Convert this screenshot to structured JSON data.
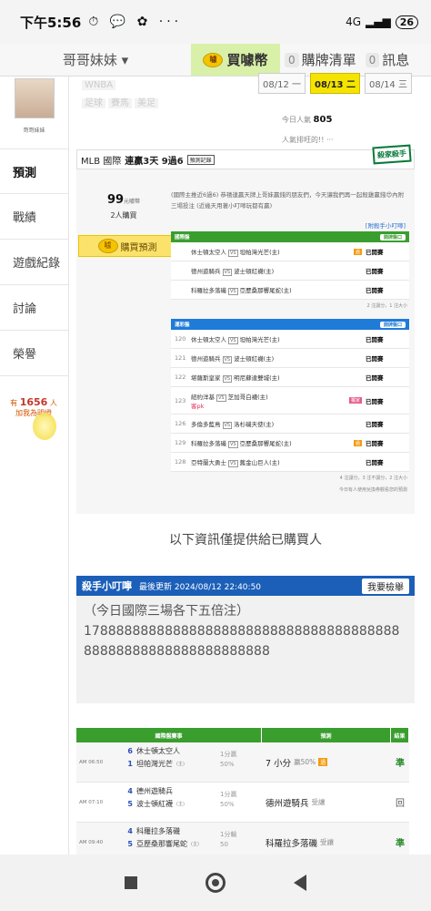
{
  "status": {
    "time": "下午5:56",
    "icons": "⏱ 💬 ✿ ···",
    "signal": "4G",
    "battery": "26"
  },
  "topnav": {
    "user": "哥哥妹妹 ▾",
    "buy": "買噱幣",
    "coin_text": "噱",
    "cart_count": "0",
    "cart_label": "購牌清單",
    "msg_count": "0",
    "msg_label": "訊息"
  },
  "sidebar": {
    "avatar_name": "哥哥妹妹",
    "items": [
      {
        "label": "預測"
      },
      {
        "label": "戰績"
      },
      {
        "label": "遊戲紀錄"
      },
      {
        "label": "討論"
      },
      {
        "label": "榮譽"
      }
    ],
    "fans_prefix": "有",
    "fans_count": "1656",
    "fans_suffix": "人",
    "fans_sub": "加我為明燈"
  },
  "tags": [
    "WNBA",
    "足球",
    "賽馬",
    "美足"
  ],
  "dates": [
    {
      "label": "08/12 一"
    },
    {
      "label": "08/13 二"
    },
    {
      "label": "08/14 三"
    }
  ],
  "popularity": {
    "label": "今日人氣",
    "value": "805",
    "sub": "人氣排旺的!! ···"
  },
  "panel": {
    "league": "MLB 國際",
    "streak": "連贏3天 9過6",
    "record_btn": "預測記錄",
    "logo": "殺家殺手",
    "price": "99",
    "price_unit": "元噱幣",
    "buyers": "2人購買",
    "buy_btn": "購買預測",
    "intro": "(國際主推近6過6) 恭禧連贏天牌上哥妹贏錢的朋友們，今天讓我們再一起殺雞贏錢😍內附三場投注 (近幾天用著小叮嚀玩都有贏)",
    "assist": "[附殺手小叮嚀]",
    "intl_title": "國際盤",
    "open_label": "開牌盤口",
    "intl_rows": [
      {
        "no": "",
        "home": "休士頓太空人",
        "away": "坦帕灣光芒(主)",
        "tag": "過",
        "status": "已開賽"
      },
      {
        "no": "",
        "home": "德州遊騎兵",
        "away": "波士頓紅襪(主)",
        "tag": "",
        "status": "已開賽"
      },
      {
        "no": "",
        "home": "科羅拉多落磯",
        "away": "亞歷桑那響尾蛇(主)",
        "tag": "",
        "status": "已開賽"
      }
    ],
    "intl_note": "2 注讓分，1 注大小",
    "tw_title": "運彩盤",
    "tw_rows": [
      {
        "no": "120",
        "home": "休士頓太空人",
        "away": "坦帕灣光芒(主)",
        "tag": "",
        "status": "已開賽"
      },
      {
        "no": "121",
        "home": "德州遊騎兵",
        "away": "波士頓紅襪(主)",
        "tag": "",
        "status": "已開賽"
      },
      {
        "no": "122",
        "home": "堪薩斯皇家",
        "away": "明尼蘇達雙城(主)",
        "tag": "",
        "status": "已開賽"
      },
      {
        "no": "123",
        "home": "紐約洋基",
        "away": "芝加哥白襪(主)",
        "tag": "",
        "status": "已開賽",
        "extra": "客pk",
        "ptag": "獨家"
      },
      {
        "no": "126",
        "no2": "",
        "home": "多倫多藍鳥",
        "away": "洛杉磯天使(主)",
        "tag": "",
        "status": "已開賽"
      },
      {
        "no": "129",
        "home": "科羅拉多落磯",
        "away": "亞歷桑那響尾蛇(主)",
        "tag": "過",
        "status": "已開賽"
      },
      {
        "no": "128",
        "home": "亞特蘭大勇士",
        "away": "舊金山巨人(主)",
        "tag": "",
        "status": "已開賽"
      }
    ],
    "tw_note": "4 注讓分，3 注不讓分，2 注大小",
    "tw_note2": "今日有人使用兌換券觀看您的預測"
  },
  "notice": "以下資訊僅提供給已購買人",
  "tip": {
    "title": "殺手小叮嚀",
    "updated": "最後更新 2024/08/12 22:40:50",
    "report": "我要檢舉",
    "body": "（今日國際三場各下五倍注）\n17888888888888888888888888888888888888888888888888888888888888"
  },
  "results": {
    "headers": [
      "國際盤賽事",
      "預測",
      "結果"
    ],
    "rows": [
      {
        "time": "AM 06:50",
        "n1": "6",
        "t1": "休士頓太空人",
        "n2": "1",
        "t2": "坦帕灣光芒",
        "t2s": "(主)",
        "odds1": "1分贏",
        "odds2": "50%",
        "pick": "7 小分",
        "pick_sm": "贏50%",
        "pick_tag": "過",
        "result": "準",
        "gray": false
      },
      {
        "time": "AM 07:10",
        "n1": "4",
        "t1": "德州遊騎兵",
        "n2": "5",
        "t2": "波士頓紅襪",
        "t2s": "(主)",
        "odds1": "1分贏",
        "odds2": "50%",
        "pick": "德州遊騎兵",
        "pick_sm": "受讓",
        "pick_tag": "",
        "result": "回",
        "gray": true
      },
      {
        "time": "AM 09:40",
        "n1": "4",
        "t1": "科羅拉多落磯",
        "n2": "5",
        "t2": "亞歷桑那響尾蛇",
        "t2s": "(主)",
        "odds1": "1分輸",
        "odds2": "50",
        "pick": "科羅拉多落磯",
        "pick_sm": "受讓",
        "pick_tag": "",
        "result": "準",
        "gray": false
      }
    ]
  }
}
